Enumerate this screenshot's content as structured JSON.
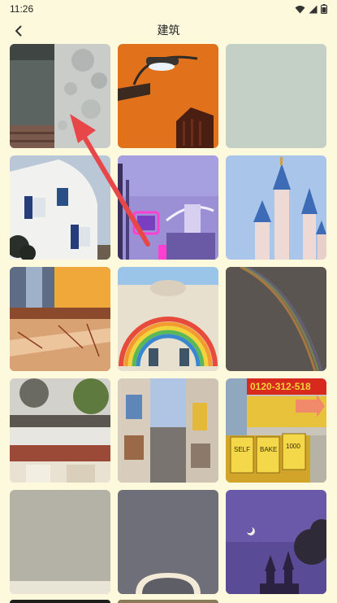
{
  "status_bar": {
    "time": "11:26"
  },
  "header": {
    "title": "建筑",
    "back_icon": "chevron-left-icon"
  },
  "gallery": {
    "tiles": [
      {
        "name": "shadow-wall-photo"
      },
      {
        "name": "orange-streetlamp-photo"
      },
      {
        "name": "pale-green-photo"
      },
      {
        "name": "white-house-blue-shutters-photo"
      },
      {
        "name": "neon-street-photo"
      },
      {
        "name": "castle-towers-photo"
      },
      {
        "name": "sunset-reflection-photo"
      },
      {
        "name": "rainbow-archway-photo"
      },
      {
        "name": "rainbow-sky-photo"
      },
      {
        "name": "storefront-street-photo"
      },
      {
        "name": "alley-street-photo"
      },
      {
        "name": "yellow-signboards-photo"
      },
      {
        "name": "grey-wall-photo"
      },
      {
        "name": "grey-arch-photo"
      },
      {
        "name": "night-castle-moon-photo"
      }
    ]
  },
  "signboard_texts": {
    "phone": "0120-312-518",
    "sign1": "SELF",
    "sign2": "BAKE",
    "sign3": "1000"
  },
  "colors": {
    "background": "#fdf9dd",
    "accent_arrow": "#e8474a"
  }
}
